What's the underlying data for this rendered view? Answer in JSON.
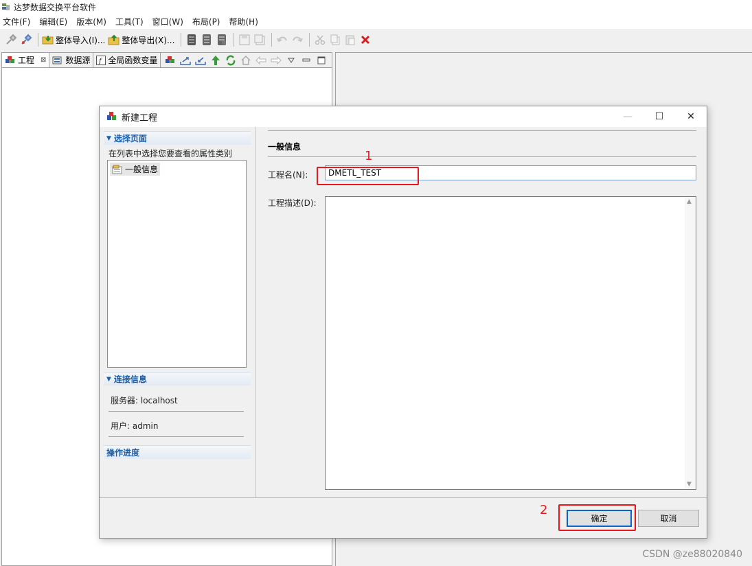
{
  "app": {
    "title": "达梦数据交换平台软件"
  },
  "menu": [
    "文件(F)",
    "编辑(E)",
    "版本(M)",
    "工具(T)",
    "窗口(W)",
    "布局(P)",
    "帮助(H)"
  ],
  "toolbar": {
    "import_label": "整体导入(I)...",
    "export_label": "整体导出(X)..."
  },
  "view_tabs": [
    {
      "label": "工程",
      "close": "⊠"
    },
    {
      "label": "数据源"
    },
    {
      "label": "全局函数变量"
    }
  ],
  "dialog": {
    "title": "新建工程",
    "controls": {
      "minimize": "—",
      "maximize": "☐",
      "close": "✕"
    },
    "left": {
      "select_page_header": "选择页面",
      "hint": "在列表中选择您要查看的属性类别",
      "pages": [
        "一般信息"
      ],
      "connection_header": "连接信息",
      "server": "服务器: localhost",
      "user": "用户: admin",
      "progress_header": "操作进度"
    },
    "right": {
      "section_title": "一般信息",
      "name_label": "工程名(N):",
      "name_value": "DMETL_TEST",
      "desc_label": "工程描述(D):",
      "desc_value": ""
    },
    "buttons": {
      "ok": "确定",
      "cancel": "取消"
    }
  },
  "annotations": {
    "marker1": "1",
    "marker2": "2",
    "color": "#e8171d"
  },
  "watermark": "CSDN @ze88020840"
}
